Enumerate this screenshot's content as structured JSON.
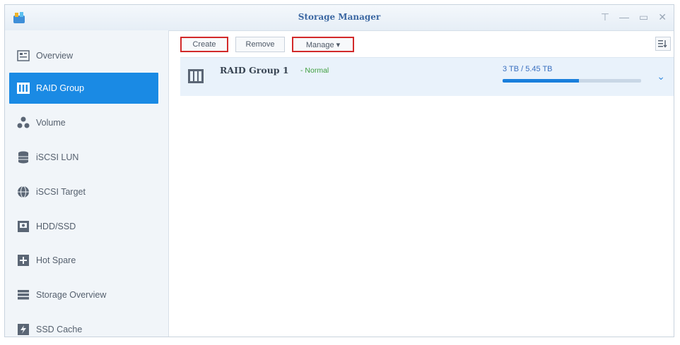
{
  "window": {
    "title": "Storage Manager"
  },
  "sidebar": {
    "items": [
      {
        "label": "Overview",
        "icon": "overview-icon"
      },
      {
        "label": "RAID Group",
        "icon": "raid-group-icon",
        "active": true
      },
      {
        "label": "Volume",
        "icon": "volume-icon"
      },
      {
        "label": "iSCSI LUN",
        "icon": "iscsi-lun-icon"
      },
      {
        "label": "iSCSI Target",
        "icon": "iscsi-target-icon"
      },
      {
        "label": "HDD/SSD",
        "icon": "hdd-icon"
      },
      {
        "label": "Hot Spare",
        "icon": "hot-spare-icon"
      },
      {
        "label": "Storage Overview",
        "icon": "storage-overview-icon"
      },
      {
        "label": "SSD Cache",
        "icon": "ssd-cache-icon"
      }
    ]
  },
  "toolbar": {
    "create_label": "Create",
    "remove_label": "Remove",
    "manage_label": "Manage ▾"
  },
  "raid_groups": [
    {
      "name": "RAID Group 1",
      "status": "- Normal",
      "usage": "3 TB / 5.45 TB",
      "used_fraction": 0.55
    }
  ],
  "colors": {
    "accent": "#1a8ae4",
    "highlight": "#d22a2a",
    "status_ok": "#3e9e3e"
  }
}
